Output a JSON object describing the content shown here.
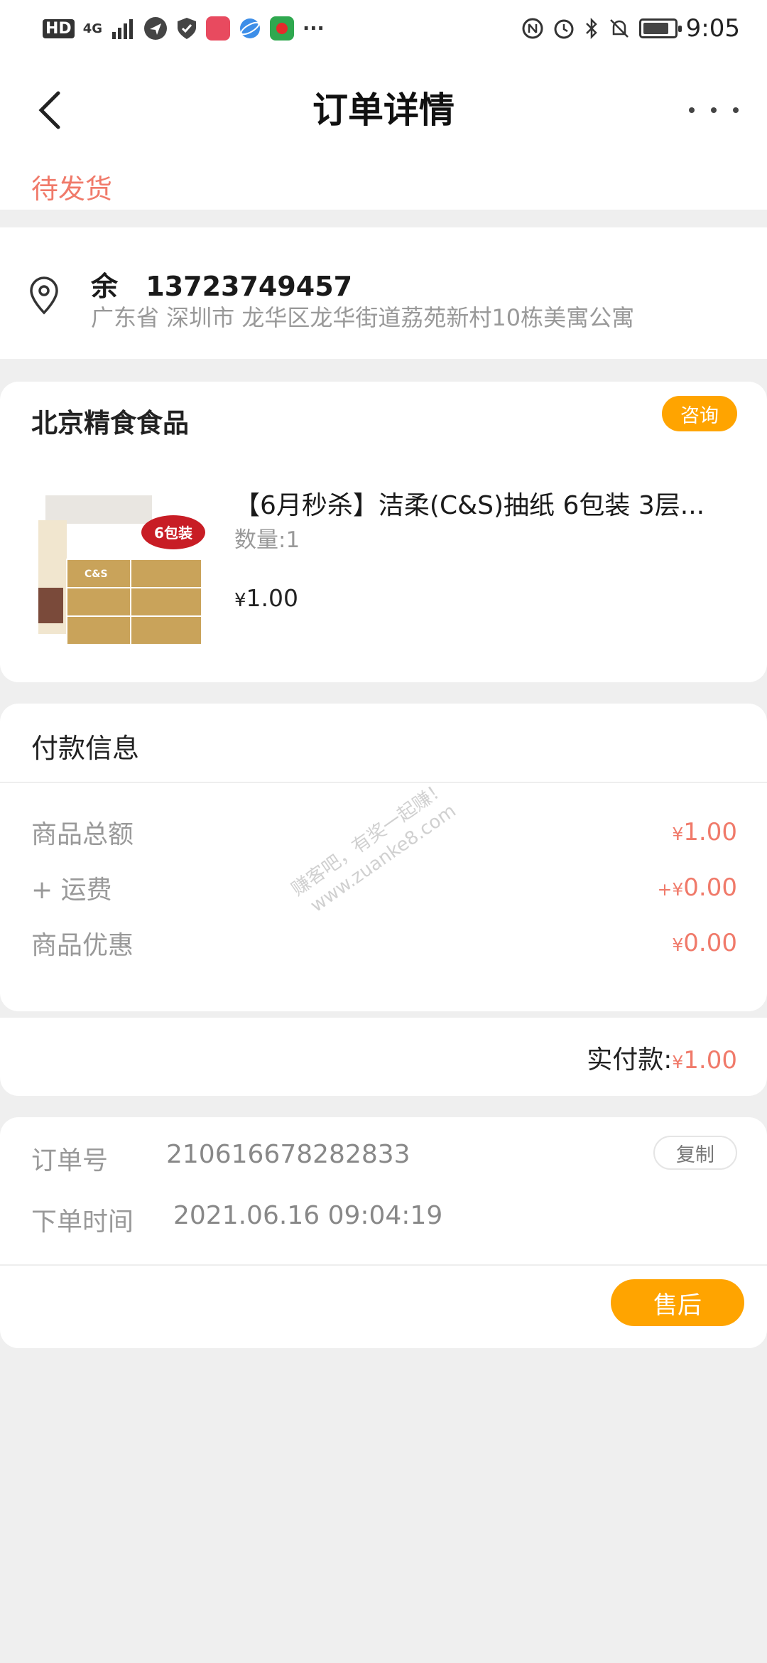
{
  "status_bar": {
    "network_badge": "HD",
    "network_type": "4G",
    "time": "9:05",
    "more_indicator": "···",
    "icons": [
      "signal-icon",
      "location-send-icon",
      "shield-icon",
      "app-icon",
      "browser-icon",
      "app-icon",
      "nfc-icon",
      "alarm-icon",
      "bluetooth-icon",
      "mute-icon",
      "battery-icon"
    ]
  },
  "header": {
    "title": "订单详情",
    "back_icon": "chevron-left-icon",
    "more_icon": "more-dots-icon"
  },
  "order_status": "待发货",
  "address": {
    "name": "余",
    "phone": "13723749457",
    "detail": "广东省 深圳市 龙华区龙华街道荔苑新村10栋美寓公寓",
    "icon": "location-pin-icon"
  },
  "shop": {
    "name": "北京精食食品",
    "consult_label": "咨询",
    "product": {
      "title": "【6月秒杀】洁柔(C&S)抽纸 6包装 3层...",
      "quantity": "数量:1",
      "currency": "¥",
      "price": "1.00",
      "image_badge": "6包装",
      "image_brand": "C&S"
    }
  },
  "payment": {
    "title": "付款信息",
    "rows": [
      {
        "label": "商品总额",
        "prefix": "",
        "currency": "¥",
        "amount": "1.00"
      },
      {
        "label": "+ 运费",
        "prefix": "+",
        "currency": "¥",
        "amount": "0.00"
      },
      {
        "label": "商品优惠",
        "prefix": "",
        "currency": "¥",
        "amount": "0.00"
      }
    ],
    "watermark_line1": "赚客吧，有奖一起赚！",
    "watermark_line2": "www.zuanke8.com"
  },
  "total": {
    "label": "实付款:",
    "currency": "¥",
    "amount": "1.00"
  },
  "order_info": {
    "order_no_label": "订单号",
    "order_no": "210616678282833",
    "copy_label": "复制",
    "time_label": "下单时间",
    "time": "2021.06.16 09:04:19",
    "aftersale_label": "售后"
  },
  "colors": {
    "accent": "#ffa400",
    "price": "#f07a6a",
    "status": "#f07a6a",
    "background": "#efefef"
  }
}
